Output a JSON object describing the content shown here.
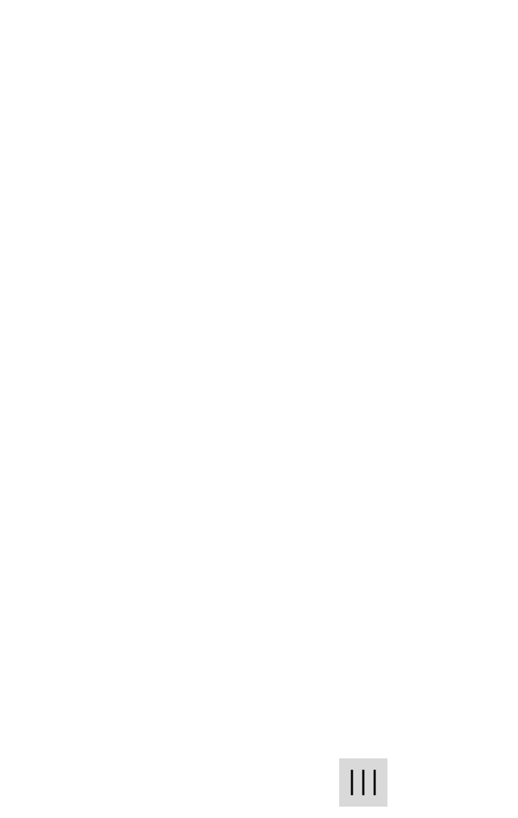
{
  "screen": {
    "background": "#ffffff"
  },
  "navigation": {
    "recent_apps_button": {
      "icon": "recent-apps-icon",
      "background": "#d9d9d9",
      "icon_color": "#000000"
    }
  }
}
